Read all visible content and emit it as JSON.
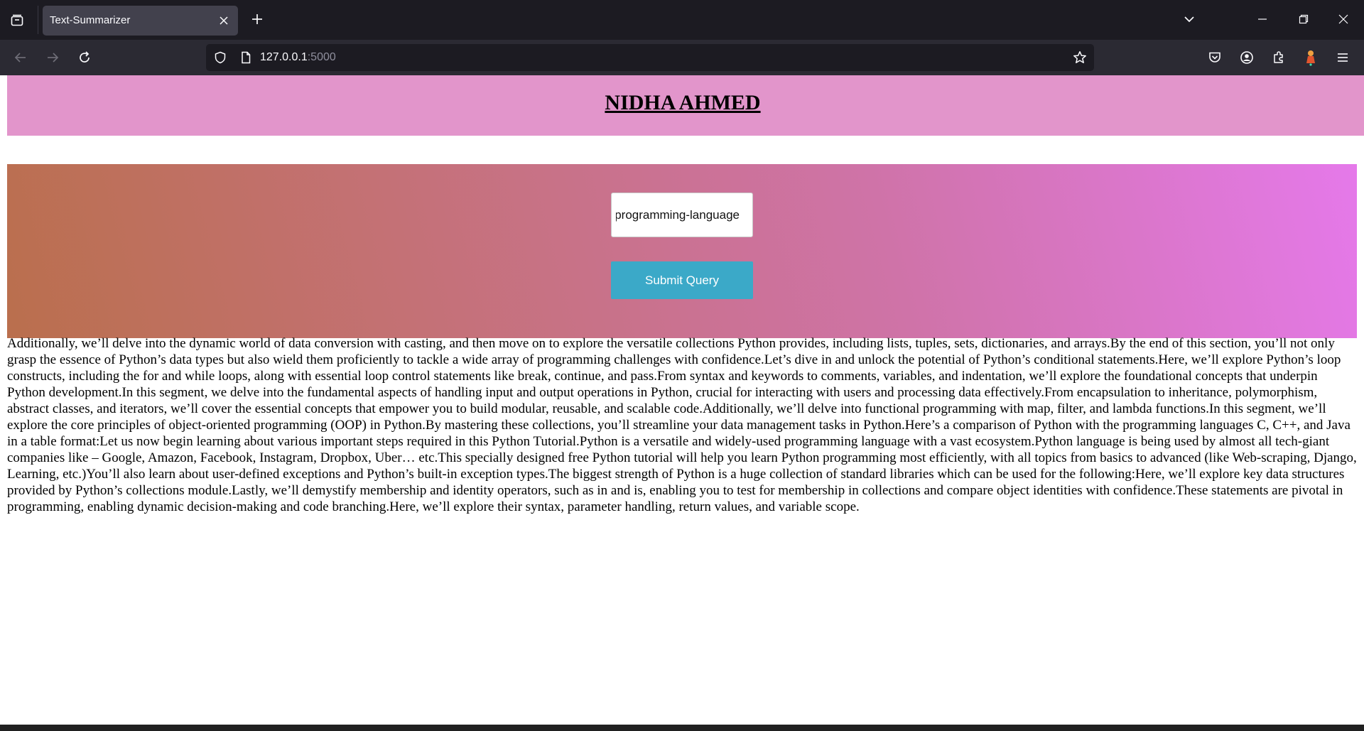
{
  "browser": {
    "tab_title": "Text-Summarizer",
    "url_host": "127.0.0.1",
    "url_port": ":5000"
  },
  "page": {
    "header_title": "NIDHA AHMED",
    "url_input_value": "programming-language/",
    "submit_label": "Submit Query",
    "summary_text": "Additionally, we’ll delve into the dynamic world of data conversion with casting, and then move on to explore the versatile collections Python provides, including lists, tuples, sets, dictionaries, and arrays.By the end of this section, you’ll not only grasp the essence of Python’s data types but also wield them proficiently to tackle a wide array of programming challenges with confidence.Let’s dive in and unlock the potential of Python’s conditional statements.Here, we’ll explore Python’s loop constructs, including the for and while loops, along with essential loop control statements like break, continue, and pass.From syntax and keywords to comments, variables, and indentation, we’ll explore the foundational concepts that underpin Python development.In this segment, we delve into the fundamental aspects of handling input and output operations in Python, crucial for interacting with users and processing data effectively.From encapsulation to inheritance, polymorphism, abstract classes, and iterators, we’ll cover the essential concepts that empower you to build modular, reusable, and scalable code.Additionally, we’ll delve into functional programming with map, filter, and lambda functions.In this segment, we’ll explore the core principles of object-oriented programming (OOP) in Python.By mastering these collections, you’ll streamline your data management tasks in Python.Here’s a comparison of Python with the programming languages C, C++, and Java in a table format:Let us now begin learning about various important steps required in this Python Tutorial.Python is a versatile and widely-used programming language with a vast ecosystem.Python language is being used by almost all tech-giant companies like – Google, Amazon, Facebook, Instagram, Dropbox, Uber… etc.This specially designed free Python tutorial will help you learn Python programming most efficiently, with all topics from basics to advanced (like Web-scraping, Django, Learning, etc.)You’ll also learn about user-defined exceptions and Python’s built-in exception types.The biggest strength of Python is a huge collection of standard libraries which can be used for the following:Here, we’ll explore key data structures provided by Python’s collections module.Lastly, we’ll demystify membership and identity operators, such as in and is, enabling you to test for membership in collections and compare object identities with confidence.These statements are pivotal in programming, enabling dynamic decision-making and code branching.Here, we’ll explore their syntax, parameter handling, return values, and variable scope."
  },
  "colors": {
    "header_band": "#e295cb",
    "gradient_start": "#ba6f4d",
    "gradient_end": "#e579ea",
    "submit_button": "#3ba9c8",
    "browser_chrome": "#1c1b22",
    "toolbar": "#2b2a33"
  },
  "icons": {
    "tabbar": [
      "tab-overview-icon",
      "close-icon",
      "plus-icon",
      "chevron-down-icon",
      "minimize-icon",
      "restore-icon",
      "close-window-icon"
    ],
    "navbar": [
      "back-arrow-icon",
      "forward-arrow-icon",
      "reload-icon",
      "shield-icon",
      "page-icon",
      "star-icon",
      "pocket-icon",
      "account-icon",
      "extensions-icon",
      "extension-fox-icon",
      "menu-icon"
    ]
  }
}
